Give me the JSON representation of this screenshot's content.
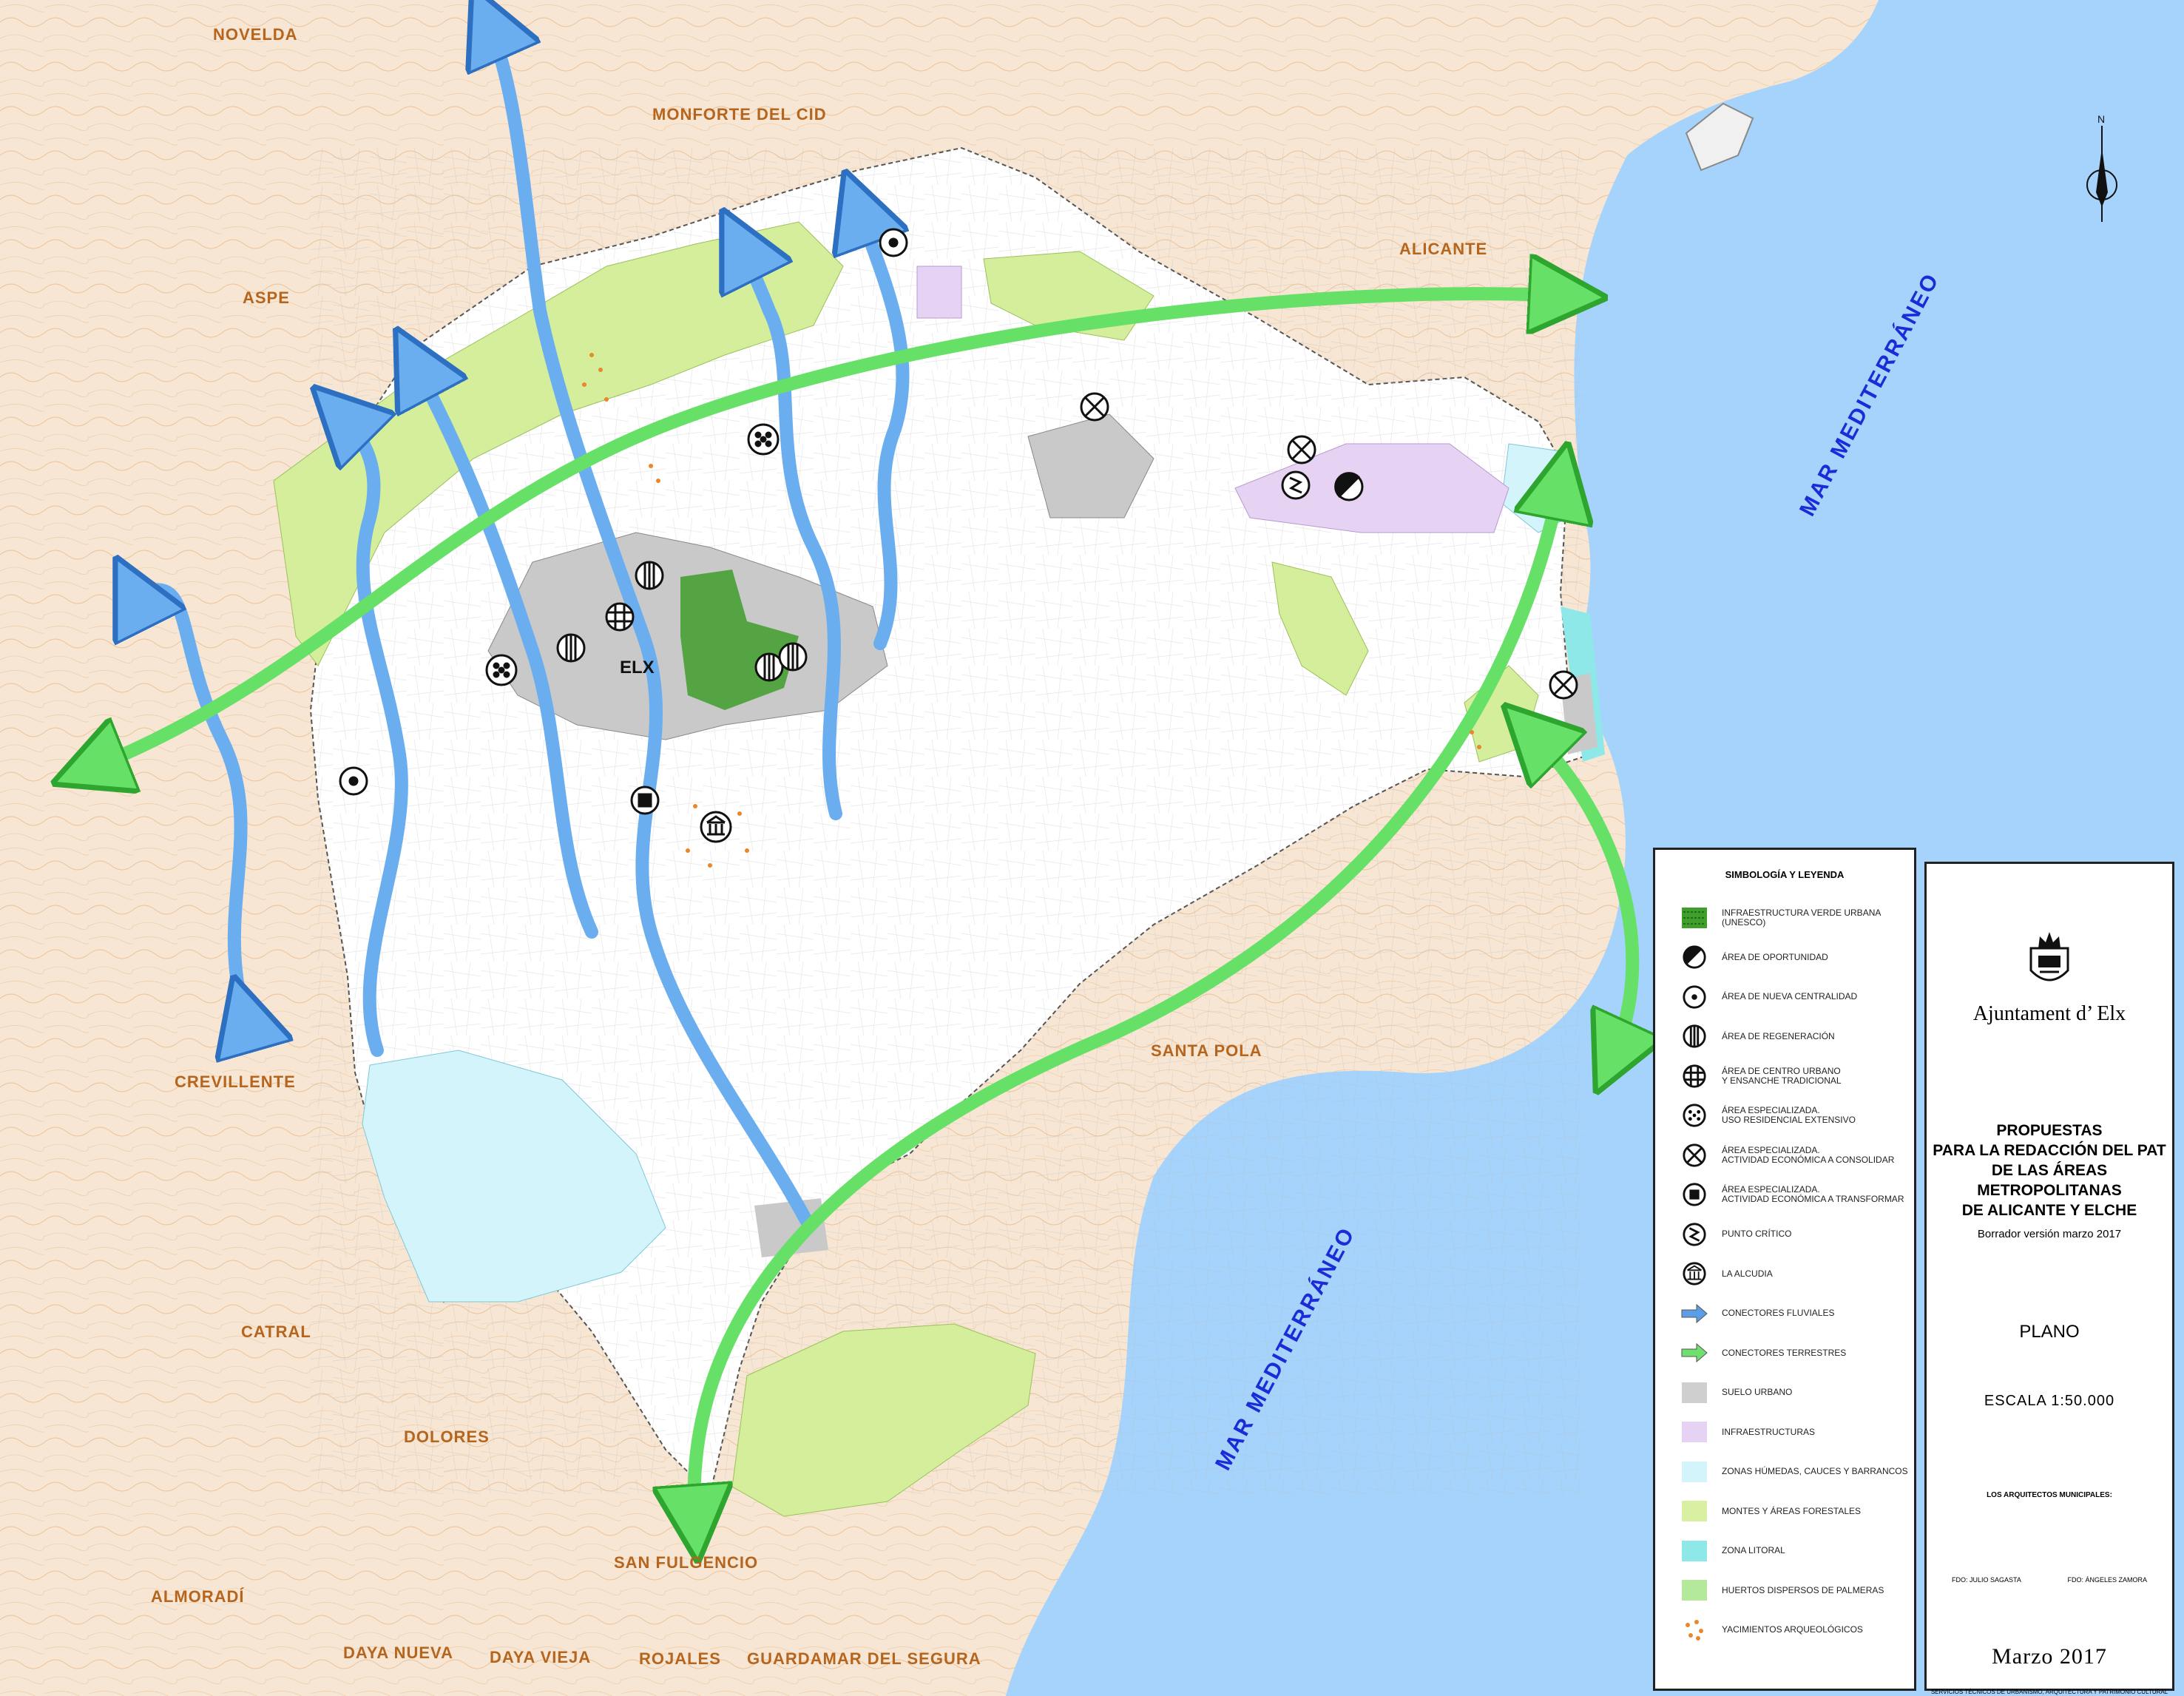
{
  "places": [
    {
      "name": "NOVELDA"
    },
    {
      "name": "MONFORTE  DEL  CID"
    },
    {
      "name": "ASPE"
    },
    {
      "name": "ALICANTE"
    },
    {
      "name": "CREVILLENTE"
    },
    {
      "name": "SANTA  POLA"
    },
    {
      "name": "CATRAL"
    },
    {
      "name": "DOLORES"
    },
    {
      "name": "SAN  FULGENCIO"
    },
    {
      "name": "ALMORADÍ"
    },
    {
      "name": "DAYA NUEVA"
    },
    {
      "name": "DAYA VIEJA"
    },
    {
      "name": "ROJALES"
    },
    {
      "name": "GUARDAMAR  DEL  SEGURA"
    }
  ],
  "city_label": "ELX",
  "sea_labels": [
    "MAR   MEDITERRÁNEO",
    "MAR   MEDITERRÁNEO"
  ],
  "north_label": "N",
  "legend": {
    "title": "SIMBOLOGÍA  Y  LEYENDA",
    "items": [
      {
        "label": "INFRAESTRUCTURA VERDE URBANA (UNESCO)",
        "icon": "green-dots-swatch",
        "color": "#3f9e2c"
      },
      {
        "label": "ÁREA DE OPORTUNIDAD",
        "icon": "half-filled-circle-icon"
      },
      {
        "label": "ÁREA DE NUEVA CENTRALIDAD",
        "icon": "dot-circle-icon"
      },
      {
        "label": "ÁREA DE REGENERACIÓN",
        "icon": "vertical-lines-circle-icon"
      },
      {
        "label": "ÁREA DE CENTRO URBANO\nY ENSANCHE TRADICIONAL",
        "icon": "grid-circle-icon"
      },
      {
        "label": "ÁREA ESPECIALIZADA.\nUSO RESIDENCIAL EXTENSIVO",
        "icon": "dots-circle-icon"
      },
      {
        "label": "ÁREA ESPECIALIZADA.\nACTIVIDAD ECONÓMICA A CONSOLIDAR",
        "icon": "cross-circle-icon"
      },
      {
        "label": "ÁREA ESPECIALIZADA.\nACTIVIDAD ECONÓMICA A TRANSFORMAR",
        "icon": "square-circle-icon"
      },
      {
        "label": "PUNTO CRÍTICO",
        "icon": "zigzag-circle-icon"
      },
      {
        "label": "LA ALCUDIA",
        "icon": "temple-circle-icon"
      },
      {
        "label": "CONECTORES FLUVIALES",
        "icon": "blue-arrow-icon",
        "color": "#5b9ee8"
      },
      {
        "label": "CONECTORES TERRESTRES",
        "icon": "green-arrow-icon",
        "color": "#6fe06f"
      },
      {
        "label": "SUELO URBANO",
        "icon": "swatch",
        "color": "#cfcfcf"
      },
      {
        "label": "INFRAESTRUCTURAS",
        "icon": "swatch",
        "color": "#e6d3f3"
      },
      {
        "label": "ZONAS HÚMEDAS, CAUCES Y BARRANCOS",
        "icon": "swatch",
        "color": "#d2f4fa"
      },
      {
        "label": "MONTES Y ÁREAS FORESTALES",
        "icon": "swatch",
        "color": "#d9f0a3"
      },
      {
        "label": "ZONA LITORAL",
        "icon": "swatch",
        "color": "#8fe8e8"
      },
      {
        "label": "HUERTOS DISPERSOS DE PALMERAS",
        "icon": "swatch",
        "color": "#b4e89a"
      },
      {
        "label": "YACIMIENTOS ARQUEOLÓGICOS",
        "icon": "orange-dots-icon",
        "color": "#e8882a"
      }
    ]
  },
  "title_block": {
    "organization": "Ajuntament d’ Elx",
    "title_lines": [
      "PROPUESTAS",
      "PARA LA REDACCIÓN DEL PAT",
      "DE LAS ÁREAS METROPOLITANAS",
      "DE ALICANTE Y ELCHE"
    ],
    "draft": "Borrador versión marzo 2017",
    "plan_label": "PLANO",
    "scale": "ESCALA 1:50.000",
    "architects": "LOS ARQUITECTOS MUNICIPALES:",
    "signature_left": "FDO: JULIO SAGASTA",
    "signature_right": "FDO: ÁNGELES ZAMORA",
    "date": "Marzo 2017",
    "services": "SERVICIOS TÉCNICOS DE URBANISMO, ARQUITECTURA Y PATRIMONIO CULTURAL"
  },
  "colors": {
    "sea": "#a6d3fb",
    "land": "#f6e6d3",
    "municipality": "#ffffff",
    "forest": "#d4ee9c",
    "urban": "#c9c9c9",
    "fluvial_arrow": "#6aaef0",
    "land_arrow": "#66e066",
    "place_label": "#b5651d",
    "sea_label": "#1b2bd8"
  }
}
